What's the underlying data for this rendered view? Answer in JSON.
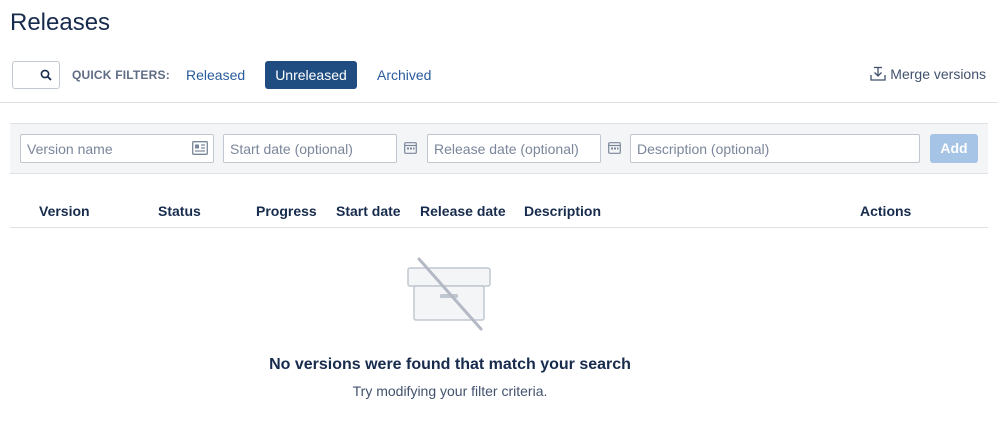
{
  "page": {
    "title": "Releases"
  },
  "filters": {
    "label": "QUICK FILTERS:",
    "released": "Released",
    "unreleased": "Unreleased",
    "archived": "Archived",
    "active": "unreleased"
  },
  "merge_label": "Merge versions",
  "form": {
    "version_placeholder": "Version name",
    "start_placeholder": "Start date (optional)",
    "release_placeholder": "Release date (optional)",
    "description_placeholder": "Description (optional)",
    "add_label": "Add"
  },
  "table": {
    "headers": [
      "Version",
      "Status",
      "Progress",
      "Start date",
      "Release date",
      "Description",
      "Actions"
    ]
  },
  "empty": {
    "title": "No versions were found that match your search",
    "subtitle": "Try modifying your filter criteria."
  },
  "colors": {
    "accent": "#1f4d82",
    "link": "#2a5b9c",
    "add_disabled": "#a5c4e6"
  },
  "icons": {
    "search": "search-icon",
    "merge": "merge-icon",
    "card": "contact-card-icon",
    "calendar": "calendar-icon",
    "empty": "empty-box-icon"
  }
}
